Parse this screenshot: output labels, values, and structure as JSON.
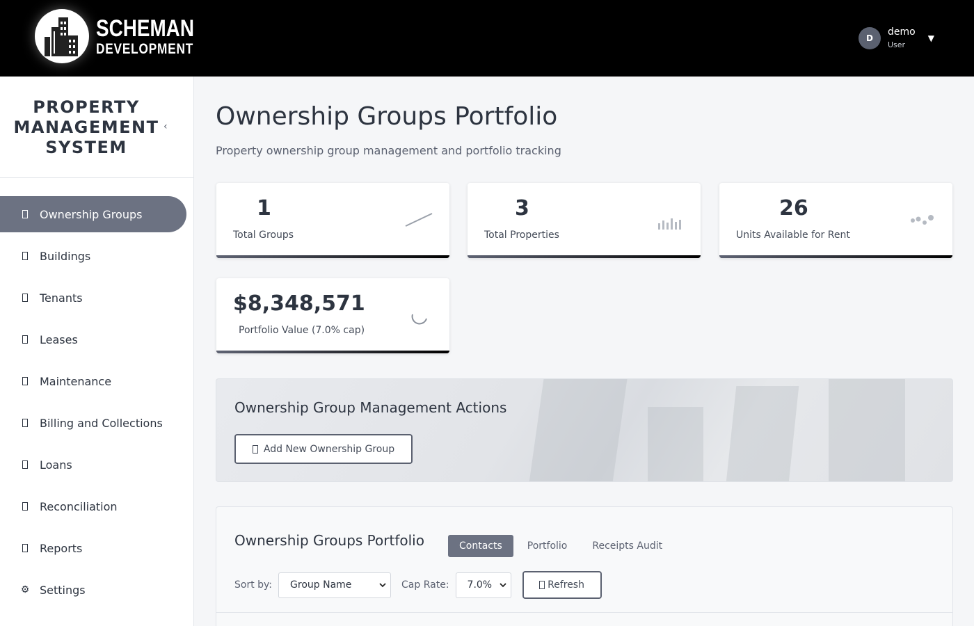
{
  "brand": {
    "line1": "SCHEMAN",
    "line2": "DEVELOPMENT"
  },
  "user": {
    "initial": "D",
    "name": "demo",
    "role": "User",
    "caret": "▼"
  },
  "sidebar": {
    "title_line1": "PROPERTY",
    "title_line2": "MANAGEMENT",
    "title_line3": "SYSTEM",
    "collapse": "‹",
    "items": [
      {
        "label": "Ownership Groups",
        "icon": "building-icon"
      },
      {
        "label": "Buildings",
        "icon": "building-icon"
      },
      {
        "label": "Tenants",
        "icon": "users-icon"
      },
      {
        "label": "Leases",
        "icon": "document-icon"
      },
      {
        "label": "Maintenance",
        "icon": "wrench-icon"
      },
      {
        "label": "Billing and Collections",
        "icon": "dollar-icon"
      },
      {
        "label": "Loans",
        "icon": "bank-icon"
      },
      {
        "label": "Reconciliation",
        "icon": "balance-icon"
      },
      {
        "label": "Reports",
        "icon": "chart-icon"
      },
      {
        "label": "Settings",
        "icon": "gear-icon",
        "glyph": "⚙"
      }
    ]
  },
  "main": {
    "title": "Ownership Groups Portfolio",
    "subtitle": "Property ownership group management and portfolio tracking"
  },
  "stats": {
    "total_groups": {
      "value": "1",
      "label": "Total Groups"
    },
    "total_properties": {
      "value": "3",
      "label": "Total Properties"
    },
    "units_available": {
      "value": "26",
      "label": "Units Available for Rent"
    },
    "portfolio_value": {
      "value": "$8,348,571",
      "label": "Portfolio Value (7.0% cap)"
    }
  },
  "actions": {
    "title": "Ownership Group Management Actions",
    "add_label": "Add New Ownership Group"
  },
  "portfolio": {
    "title": "Ownership Groups Portfolio",
    "tabs": [
      "Contacts",
      "Portfolio",
      "Receipts Audit"
    ],
    "active_tab": "Contacts",
    "sort_label": "Sort by:",
    "sort_value": "Group Name",
    "cap_label": "Cap Rate:",
    "cap_value": "7.0%",
    "refresh_label": "Refresh"
  },
  "colors": {
    "accent": "#6c7282",
    "topbar": "#000000",
    "text": "#2d3440"
  }
}
